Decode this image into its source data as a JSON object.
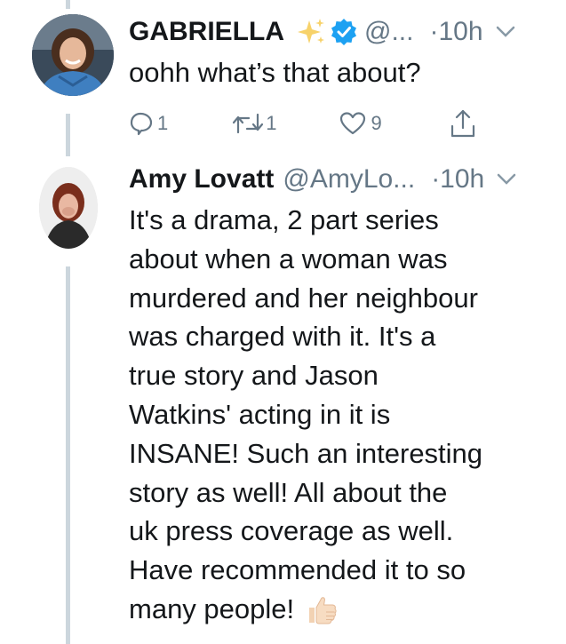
{
  "tweets": [
    {
      "display_name": "GABRIELLA",
      "handle": "@...",
      "time": "·10h",
      "text": "oohh what’s that about?",
      "counts": {
        "replies": "1",
        "retweets": "1",
        "likes": "9"
      }
    },
    {
      "display_name": "Amy Lovatt",
      "handle": "@AmyLo...",
      "time": "·10h",
      "lines": [
        "It's a drama, 2 part series",
        "about when a woman was",
        "murdered and her neighbour",
        "was charged with it. It's a",
        "true story and Jason",
        "Watkins' acting in it is",
        "INSANE! Such an interesting",
        "story as well! All about the",
        "uk press coverage as well.",
        "Have recommended it to so",
        "many people!"
      ]
    }
  ],
  "icons": {
    "sparkles": "sparkles-icon",
    "verified": "verified-badge-icon",
    "caret": "chevron-down-icon",
    "reply": "reply-icon",
    "retweet": "retweet-icon",
    "like": "heart-icon",
    "share": "share-icon",
    "emoji": "thumbs-up-emoji"
  },
  "colors": {
    "verified": "#1da1f2",
    "muted": "#657786",
    "thread_line": "#ccd6dd",
    "text": "#14171a"
  }
}
